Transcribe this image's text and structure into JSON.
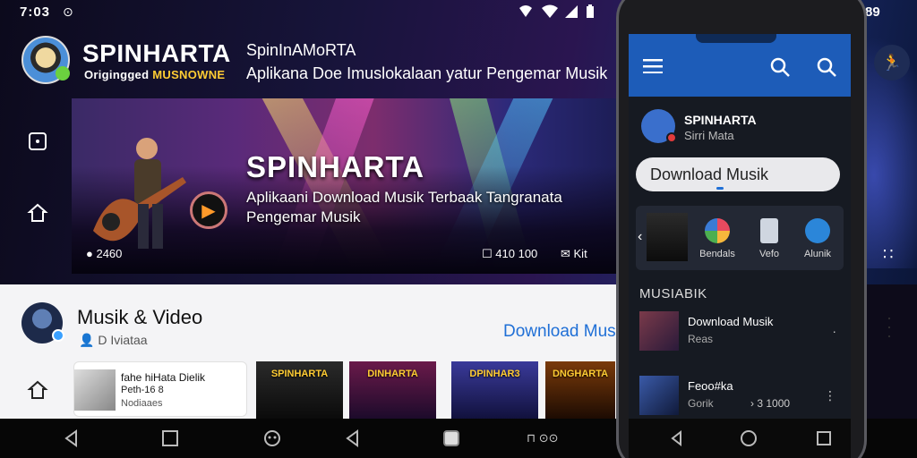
{
  "status_bar": {
    "time": "7:03",
    "battery_right": "89"
  },
  "header": {
    "brand_main": "SPINHARTA",
    "brand_sub_left": "Origingged",
    "brand_sub_right": "MUSNOWNE",
    "title": "SpinInAMoRTA",
    "description": "Aplikana Doe Imuslokalaan yatur Pengemar Musik"
  },
  "banner": {
    "title": "SPINHARTA",
    "description": "Aplikaani Download Musik Terbaak Tangranata Pengemar Musik",
    "stat_left": "2460",
    "stat_mid": "410 100",
    "stat_right": "Kit"
  },
  "section": {
    "title": "Musik & Video",
    "subtitle": "D Iviataa",
    "link": "Download Musik",
    "card": {
      "line1": "fahe hiHata Dielik",
      "line2": "Peth-16 8",
      "line3": "Nodiaaes"
    },
    "albums": [
      {
        "label": "SPINHARTA",
        "bg": "#1a1a1a"
      },
      {
        "label": "DINHARTA",
        "bg": "#3a1a4a"
      },
      {
        "label": "DPINHAR3",
        "bg": "#2a2a6a"
      },
      {
        "label": "DNGHARTA",
        "bg": "#3a1608"
      }
    ]
  },
  "phone": {
    "profile_name": "SPINHARTA",
    "profile_sub": "Sirri Mata",
    "download_btn": "Download Musik",
    "categories": [
      {
        "label": "Bendals",
        "color": "#e84a5f"
      },
      {
        "label": "Vefo",
        "color": "#cfd6e0"
      },
      {
        "label": "Alunik",
        "color": "#2b86d9"
      }
    ],
    "section_title": "MUSIABIK",
    "rows": [
      {
        "title": "Download Musik",
        "sub": "Reas",
        "meta": ""
      },
      {
        "title": "Feoo#ka",
        "sub": "Gorik",
        "meta": "3 1000"
      }
    ]
  },
  "colors": {
    "accent_blue": "#1f6fd6",
    "brand_yellow": "#ffb000",
    "appbar": "#1d5cb8"
  }
}
